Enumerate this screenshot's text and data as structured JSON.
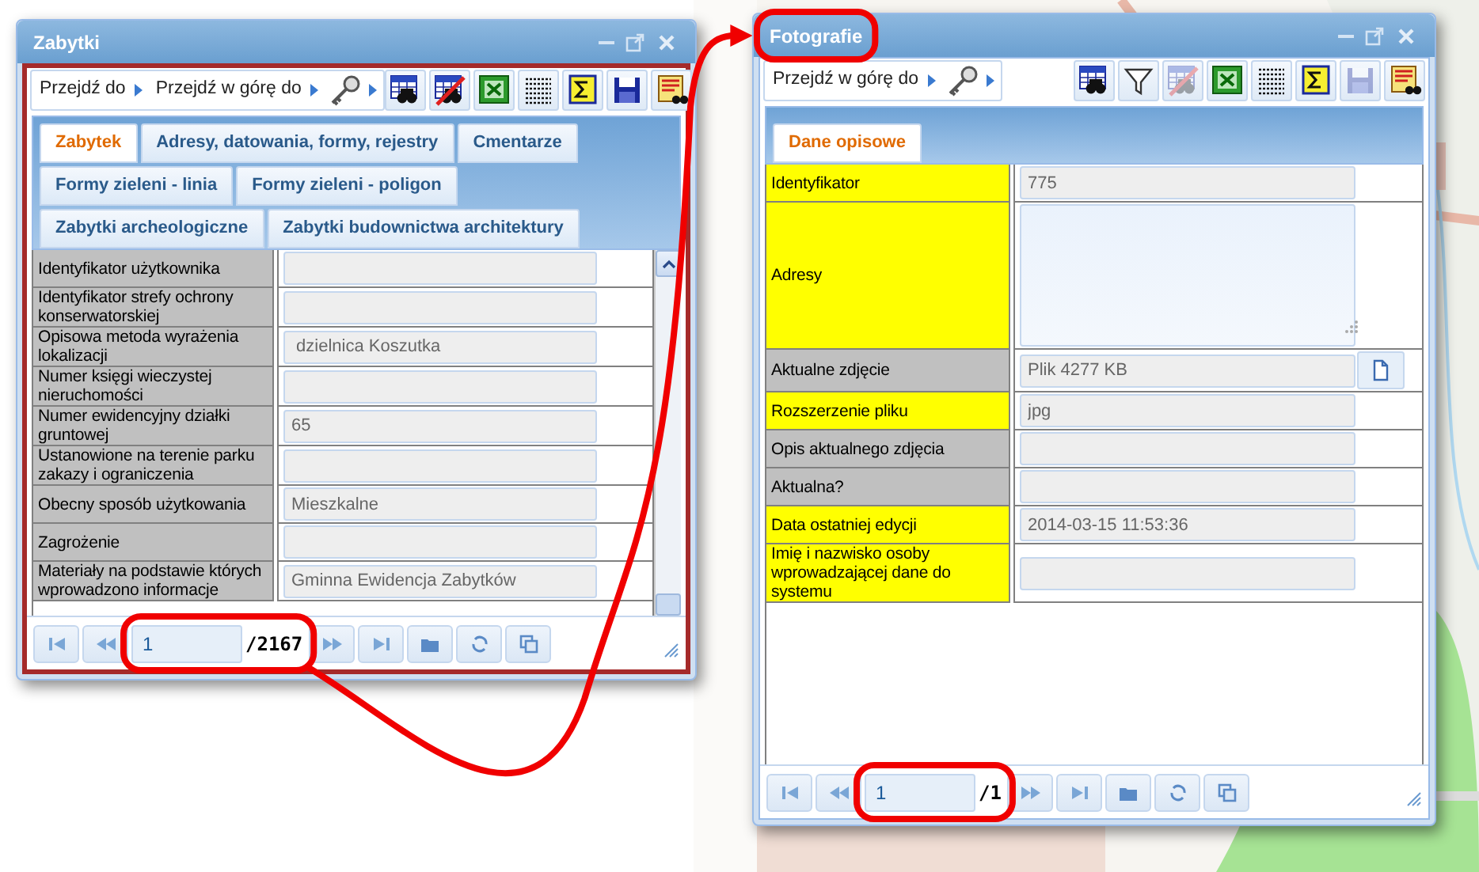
{
  "windows": [
    {
      "title": "Zabytki",
      "highlighted": true,
      "scrollable": true,
      "toolbar": {
        "nav": [
          {
            "label": "Przejdź do"
          },
          {
            "label": "Przejdź w górę do"
          }
        ],
        "tools": [
          {
            "kind": "find",
            "disabled": false
          },
          {
            "kind": "clear-find",
            "disabled": false
          },
          {
            "kind": "excel",
            "disabled": false
          },
          {
            "kind": "table",
            "disabled": false
          },
          {
            "kind": "sum",
            "disabled": false
          },
          {
            "kind": "save",
            "disabled": false
          },
          {
            "kind": "report",
            "disabled": false
          }
        ]
      },
      "tabs": [
        {
          "label": "Zabytek",
          "selected": true
        },
        {
          "label": "Adresy, datowania, formy, rejestry",
          "selected": false
        },
        {
          "label": "Cmentarze",
          "selected": false
        },
        {
          "label": "Formy zieleni - linia",
          "selected": false
        },
        {
          "label": "Formy zieleni - poligon",
          "selected": false
        },
        {
          "label": "Zabytki archeologiczne",
          "selected": false
        },
        {
          "label": "Zabytki budownictwa architektury",
          "selected": false
        }
      ],
      "form": [
        {
          "kind": "text",
          "label": "Identyfikator użytkownika",
          "color": "#c0c0c0"
        },
        {
          "kind": "text",
          "label": "Identyfikator strefy ochrony konserwatorskiej",
          "color": "#c0c0c0"
        },
        {
          "kind": "text",
          "label": "Opisowa metoda wyrażenia lokalizacji",
          "color": "#c0c0c0",
          "value": " dzielnica Koszutka"
        },
        {
          "kind": "text",
          "label": "Numer księgi wieczystej nieruchomości",
          "color": "#c0c0c0"
        },
        {
          "kind": "text",
          "label": "Numer ewidencyjny działki gruntowej",
          "color": "#c0c0c0",
          "value": "65"
        },
        {
          "kind": "text",
          "label": "Ustanowione na terenie parku zakazy i ograniczenia",
          "color": "#c0c0c0"
        },
        {
          "kind": "text",
          "label": "Obecny sposób użytkowania",
          "color": "#c0c0c0",
          "value": "Mieszkalne"
        },
        {
          "kind": "text",
          "label": "Zagrożenie",
          "color": "#c0c0c0"
        },
        {
          "kind": "text",
          "label": "Materiały na podstawie których wprowadzono informacje",
          "color": "#c0c0c0",
          "value": "Gminna Ewidencja Zabytków"
        }
      ],
      "pager": {
        "page": "1",
        "total": "/2167"
      }
    },
    {
      "title": "Fotografie",
      "highlighted": false,
      "scrollable": false,
      "toolbar": {
        "nav": [
          {
            "label": "Przejdź w górę do"
          }
        ],
        "tools": [
          {
            "kind": "find",
            "disabled": false
          },
          {
            "kind": "filter",
            "disabled": false
          },
          {
            "kind": "clear-find",
            "disabled": true
          },
          {
            "kind": "excel",
            "disabled": false
          },
          {
            "kind": "table",
            "disabled": false
          },
          {
            "kind": "sum",
            "disabled": false
          },
          {
            "kind": "save",
            "disabled": true
          },
          {
            "kind": "report",
            "disabled": false
          }
        ]
      },
      "tabs": [
        {
          "label": "Dane opisowe",
          "selected": true
        }
      ],
      "form": [
        {
          "kind": "text",
          "label": "Identyfikator",
          "color": "#ffff00",
          "value": "775"
        },
        {
          "kind": "textarea",
          "label": "Adresy",
          "color": "#ffff00"
        },
        {
          "kind": "file",
          "label": "Aktualne zdjęcie",
          "color": "#c0c0c0",
          "value": "Plik 4277 KB"
        },
        {
          "kind": "text",
          "label": "Rozszerzenie pliku",
          "color": "#ffff00",
          "value": "jpg"
        },
        {
          "kind": "text",
          "label": "Opis aktualnego zdjęcia",
          "color": "#c0c0c0"
        },
        {
          "kind": "text",
          "label": "Aktualna?",
          "color": "#c0c0c0"
        },
        {
          "kind": "text",
          "label": "Data ostatniej edycji",
          "color": "#ffff00",
          "value": "2014-03-15 11:53:36"
        },
        {
          "kind": "text",
          "label": "Imię i nazwisko osoby wprowadzającej dane do systemu",
          "color": "#ffff00"
        }
      ],
      "pager": {
        "page": "1",
        "total": "/1"
      }
    }
  ]
}
